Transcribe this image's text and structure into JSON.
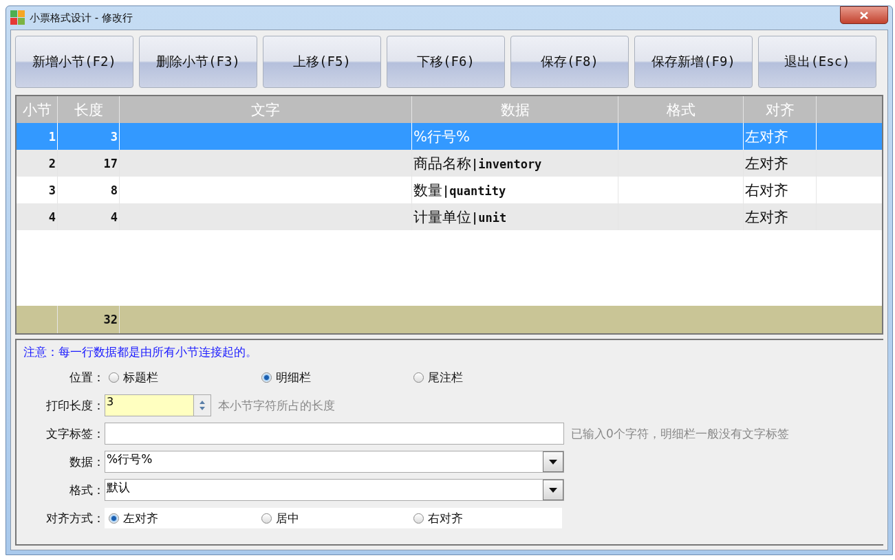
{
  "window": {
    "title": "小票格式设计 - 修改行"
  },
  "toolbar": [
    "新增小节(F2)",
    "删除小节(F3)",
    "上移(F5)",
    "下移(F6)",
    "保存(F8)",
    "保存新增(F9)",
    "退出(Esc)"
  ],
  "table": {
    "columns": [
      "小节",
      "长度",
      "文字",
      "数据",
      "格式",
      "对齐"
    ],
    "rows": [
      {
        "cells": [
          "1",
          "3",
          "",
          "%行号%",
          "",
          "左对齐"
        ],
        "selected": true
      },
      {
        "cells": [
          "2",
          "17",
          "",
          "商品名称**|inventory**",
          "",
          "左对齐"
        ],
        "selected": false
      },
      {
        "cells": [
          "3",
          "8",
          "",
          "数量**|quantity**",
          "",
          "右对齐"
        ],
        "selected": false
      },
      {
        "cells": [
          "4",
          "4",
          "",
          "计量单位**|unit**",
          "",
          "左对齐"
        ],
        "selected": false
      }
    ],
    "total": {
      "length": "32"
    }
  },
  "form": {
    "note": "注意：每一行数据都是由所有小节连接起的。",
    "position": {
      "label": "位置：",
      "options": [
        {
          "label": "标题栏",
          "selected": false
        },
        {
          "label": "明细栏",
          "selected": true
        },
        {
          "label": "尾注栏",
          "selected": false
        }
      ]
    },
    "print_length": {
      "label": "打印长度：",
      "value": "3",
      "hint": "本小节字符所占的长度"
    },
    "text_label": {
      "label": "文字标签：",
      "hint": "已输入0个字符，明细栏一般没有文字标签"
    },
    "data": {
      "label": "数据：",
      "value": "%行号%"
    },
    "format": {
      "label": "格式：",
      "value": "默认"
    },
    "alignment": {
      "label": "对齐方式：",
      "options": [
        {
          "label": "左对齐",
          "selected": true
        },
        {
          "label": "居中",
          "selected": false
        },
        {
          "label": "右对齐",
          "selected": false
        }
      ]
    }
  }
}
